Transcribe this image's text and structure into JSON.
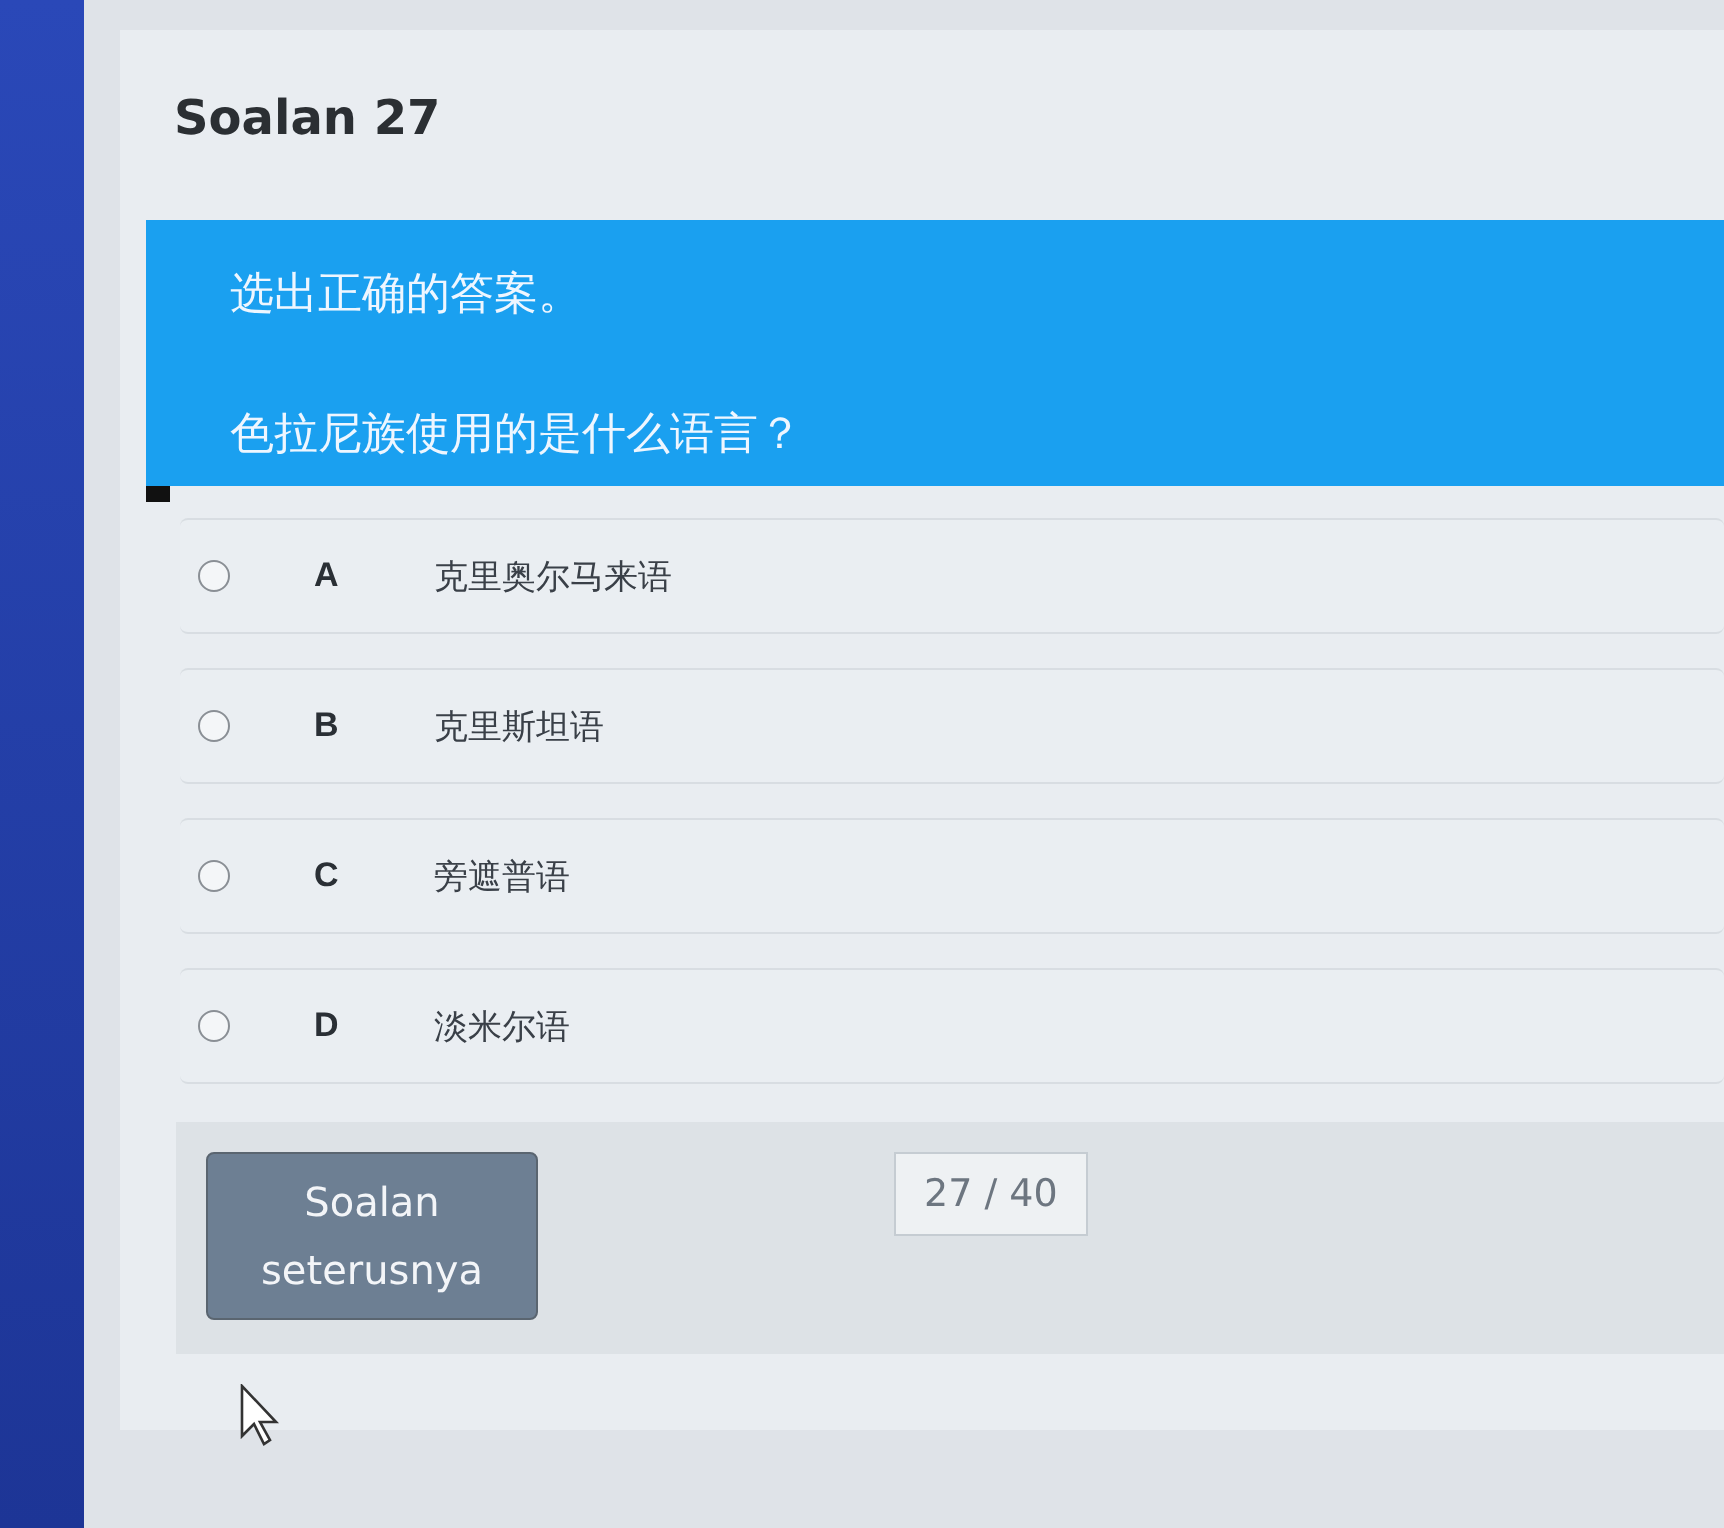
{
  "question": {
    "title": "Soalan 27",
    "instruction": "选出正确的答案。",
    "prompt": "色拉尼族使用的是什么语言？"
  },
  "options": [
    {
      "letter": "A",
      "text": "克里奥尔马来语",
      "selected": false
    },
    {
      "letter": "B",
      "text": "克里斯坦语",
      "selected": false
    },
    {
      "letter": "C",
      "text": "旁遮普语",
      "selected": false
    },
    {
      "letter": "D",
      "text": "淡米尔语",
      "selected": false
    }
  ],
  "footer": {
    "next_button": "Soalan seterusnya",
    "counter": "27 / 40"
  }
}
